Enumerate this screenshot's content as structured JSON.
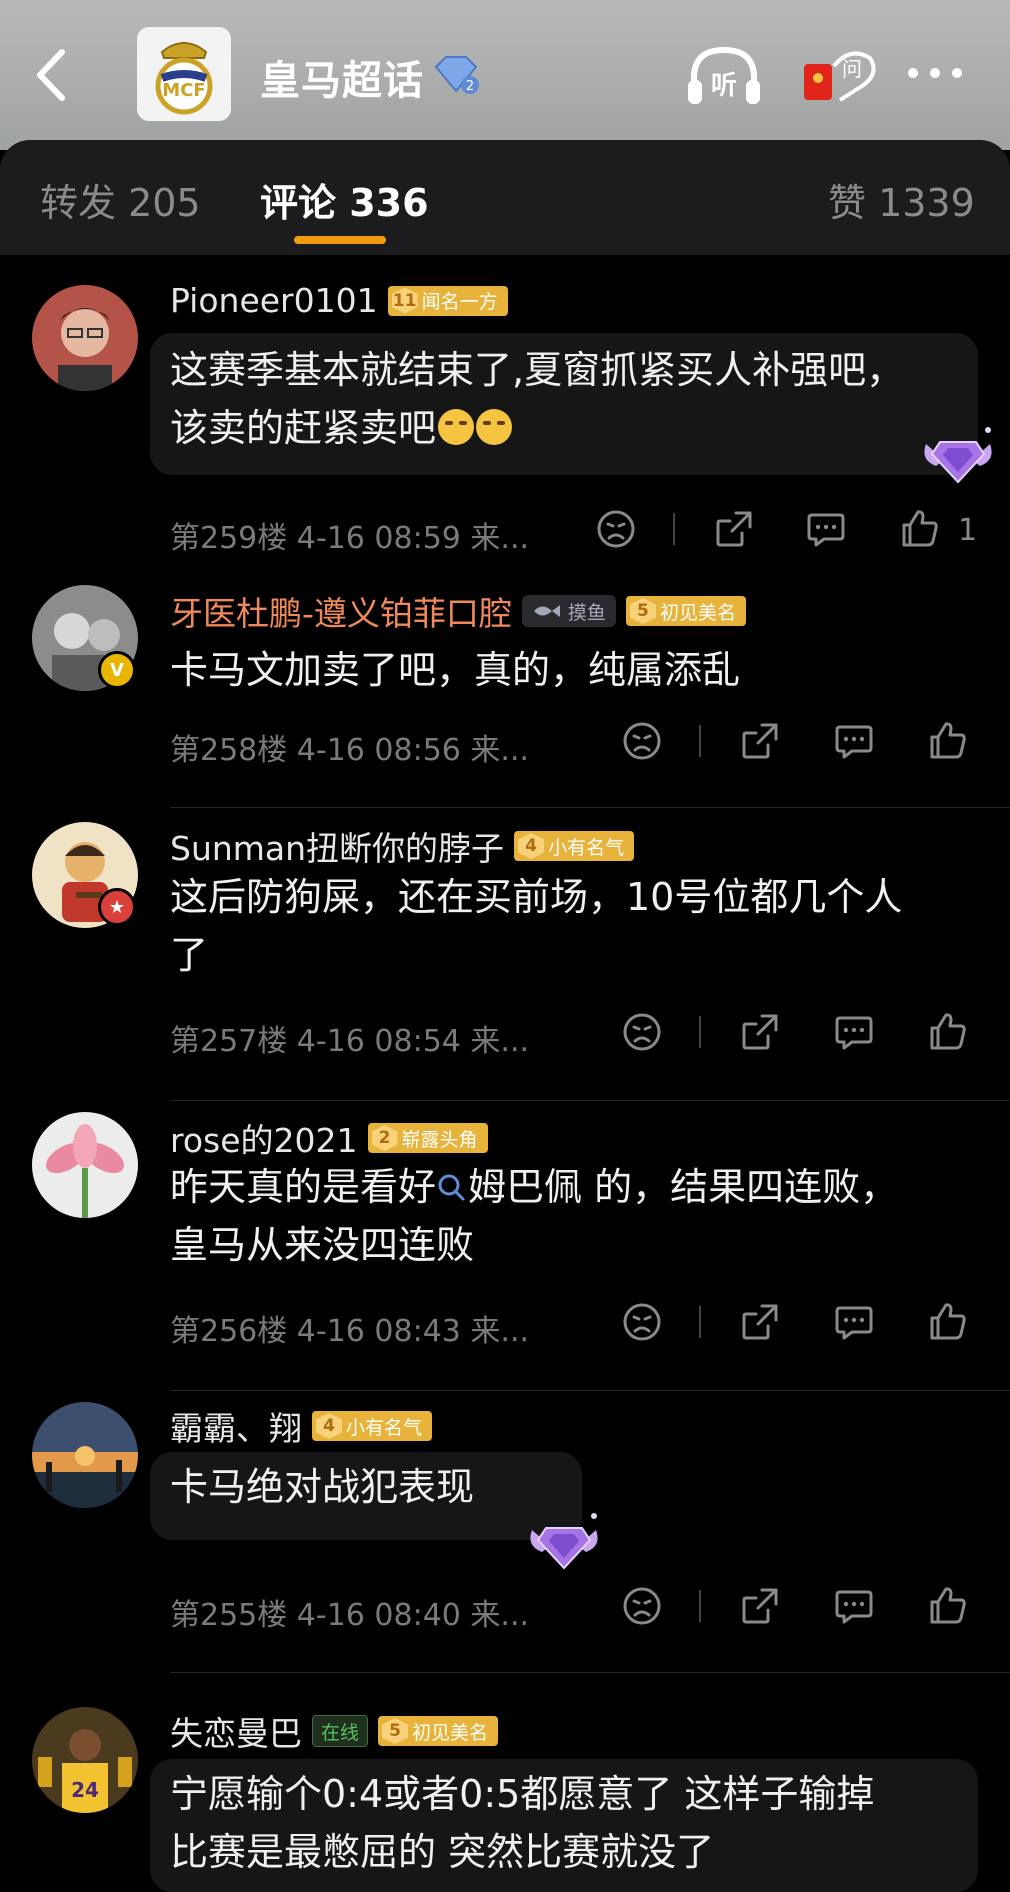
{
  "header": {
    "title": "皇马超话",
    "rank_badge": "2",
    "listen_label": "听",
    "ask_label": "问",
    "icons": [
      "back-arrow-icon",
      "real-madrid-logo",
      "diamond-rank-icon",
      "headphone-icon",
      "redpacket-ask-icon",
      "more-icon"
    ]
  },
  "tabs": [
    {
      "label": "转发 205"
    },
    {
      "label": "评论 336"
    },
    {
      "label": "赞 1339"
    }
  ],
  "colors": {
    "accent": "#f39c12",
    "badge_gold": "#e8b33b",
    "online_green": "#58c05d",
    "vip_name": "#f08a58"
  },
  "comments": [
    {
      "user": "Pioneer0101",
      "badge_level": "11",
      "badge_text": "闻名一方",
      "text": "这赛季基本就结束了,夏窗抓紧买人补强吧，该卖的赶紧卖吧",
      "line1": "这赛季基本就结束了,夏窗抓紧买人补强吧，",
      "line2": "该卖的赶紧卖吧",
      "meta": "第259楼 4-16 08:59 来...",
      "likes": "1"
    },
    {
      "user": "牙医杜鹏-遵义铂菲口腔",
      "fish_text": "摸鱼",
      "badge_level": "5",
      "badge_text": "初见美名",
      "text": "卡马文加卖了吧，真的，纯属添乱",
      "meta": "第258楼 4-16 08:56 来..."
    },
    {
      "user": "Sunman扭断你的脖子",
      "badge_level": "4",
      "badge_text": "小有名气",
      "line1": "这后防狗屎，还在买前场，10号位都几个人",
      "line2": "了",
      "meta": "第257楼 4-16 08:54 来..."
    },
    {
      "user": "rose的2021",
      "badge_level": "2",
      "badge_text": "崭露头角",
      "line1_a": "昨天真的是看好",
      "line1_link": "姆巴佩",
      "line1_b": " 的，结果四连败，",
      "line2": "皇马从来没四连败",
      "meta": "第256楼 4-16 08:43 来..."
    },
    {
      "user": "霸霸、翔",
      "badge_level": "4",
      "badge_text": "小有名气",
      "text": "卡马绝对战犯表现",
      "meta": "第255楼 4-16 08:40 来..."
    },
    {
      "user": "失恋曼巴",
      "online_text": "在线",
      "badge_level": "5",
      "badge_text": "初见美名",
      "line1": "宁愿输个0:4或者0:5都愿意了 这样子输掉",
      "line2": "比赛是最憋屈的 突然比赛就没了"
    }
  ]
}
